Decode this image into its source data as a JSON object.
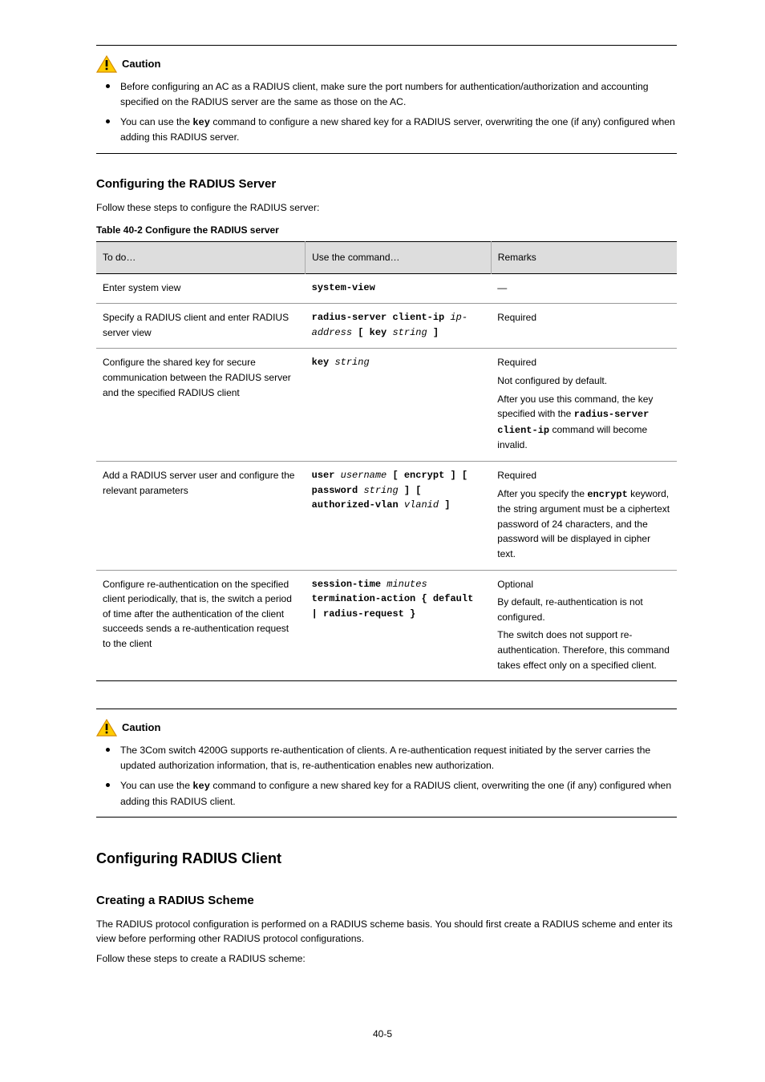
{
  "caution1": {
    "label": "Caution",
    "items": [
      "Before configuring an AC as a RADIUS client, make sure the port numbers for authentication/authorization and accounting specified on the RADIUS server are the same as those on the AC.",
      "You can use the <mono>key</mono> command to configure a new shared key for a RADIUS server, overwriting the one (if any) configured when adding this RADIUS server."
    ]
  },
  "section1": {
    "title": "Configuring the RADIUS Server",
    "intro": "Follow these steps to configure the RADIUS server:",
    "tableCaption": "Table 40-2 Configure the RADIUS server",
    "headers": [
      "To do…",
      "Use the command…",
      "Remarks"
    ],
    "rows": [
      {
        "todo": "Enter system view",
        "cmd": "system-view",
        "remarks": "—"
      },
      {
        "todo": "Specify a RADIUS client and enter RADIUS server view",
        "cmdParts": [
          {
            "t": "radius-server client-ip ",
            "arg": false
          },
          {
            "t": "ip-address",
            "arg": true
          },
          {
            "t": " [ ",
            "arg": false
          },
          {
            "t": "key",
            "arg": false
          },
          {
            "t": " ",
            "arg": false
          },
          {
            "t": "string",
            "arg": true
          },
          {
            "t": " ]",
            "arg": false
          }
        ],
        "remarks": "Required"
      },
      {
        "todo": "Configure the shared key for secure communication between the RADIUS server and the specified RADIUS client",
        "cmdParts": [
          {
            "t": "key ",
            "arg": false
          },
          {
            "t": "string",
            "arg": true
          }
        ],
        "remarksLines": [
          "Required",
          "Not configured by default.",
          "After you use this command, the key specified with the <mono>radius-server client-ip</mono> command will become invalid."
        ]
      },
      {
        "todo": "Add a RADIUS server user and configure the relevant parameters",
        "cmdParts": [
          {
            "t": "user ",
            "arg": false
          },
          {
            "t": "username",
            "arg": true
          },
          {
            "t": " [ ",
            "arg": false
          },
          {
            "t": "encrypt",
            "arg": false
          },
          {
            "t": " ] [ ",
            "arg": false
          },
          {
            "t": "password",
            "arg": false
          },
          {
            "t": " ",
            "arg": false
          },
          {
            "t": "string",
            "arg": true
          },
          {
            "t": " ] [ ",
            "arg": false
          },
          {
            "t": "authorized-vlan",
            "arg": false
          },
          {
            "t": " ",
            "arg": false
          },
          {
            "t": "vlanid",
            "arg": true
          },
          {
            "t": " ]",
            "arg": false
          }
        ],
        "remarksLines": [
          "Required",
          "After you specify the <mono>encrypt</mono> keyword, the string argument must be a ciphertext password of 24 characters, and the password will be displayed in cipher text."
        ]
      },
      {
        "todo": "Configure re-authentication on the specified client periodically, that is, the switch a period of time after the authentication of the client succeeds sends a re-authentication request to the client",
        "cmdParts": [
          {
            "t": "session-time ",
            "arg": false
          },
          {
            "t": "minutes",
            "arg": true
          },
          {
            "t": " termination-action",
            "arg": false
          },
          {
            "t": " { ",
            "arg": false
          },
          {
            "t": "default",
            "arg": false
          },
          {
            "t": " | ",
            "arg": false
          },
          {
            "t": "radius-request",
            "arg": false
          },
          {
            "t": " }",
            "arg": false
          }
        ],
        "remarksLines": [
          "Optional",
          "By default, re-authentication is not configured.",
          "The switch does not support re-authentication. Therefore, this command takes effect only on a specified client."
        ]
      }
    ]
  },
  "caution2": {
    "label": "Caution",
    "items": [
      "The 3Com switch 4200G supports re-authentication of clients. A re-authentication request initiated by the server carries the updated authorization information, that is, re-authentication enables new authorization.",
      "You can use the <mono>key</mono> command to configure a new shared key for a RADIUS client, overwriting the one (if any) configured when adding this RADIUS client."
    ]
  },
  "h1": "Configuring RADIUS Client",
  "section2": {
    "title": "Creating a RADIUS Scheme",
    "paras": [
      "The RADIUS protocol configuration is performed on a RADIUS scheme basis. You should first create a RADIUS scheme and enter its view before performing other RADIUS protocol configurations.",
      "Follow these steps to create a RADIUS scheme:"
    ]
  },
  "pageNumber": "40-5"
}
